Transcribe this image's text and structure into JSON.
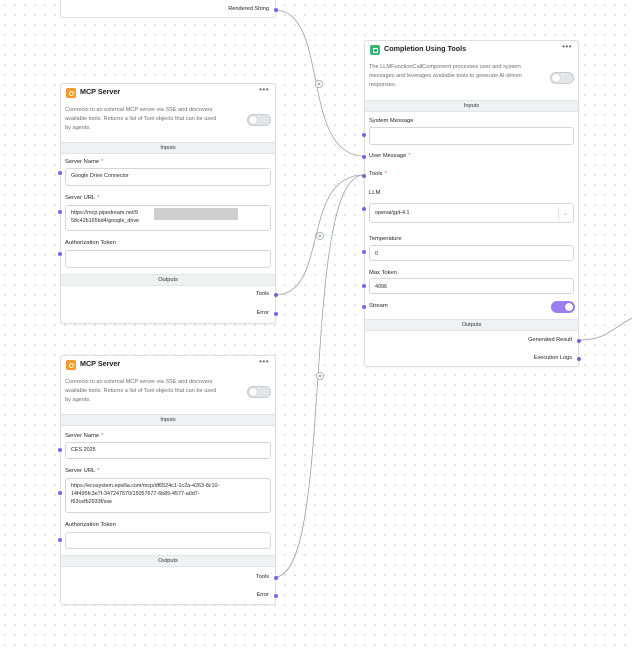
{
  "colors": {
    "accent": "#7b62e0",
    "toggle_on": "#9b7ef2",
    "mcp_icon": "#f09a2a",
    "llm_icon": "#3cb371",
    "required": "#e45757",
    "edge": "#9aa0aa"
  },
  "top_node": {
    "output_rendered_string": "Rendered String"
  },
  "mcp1": {
    "icon": "mcp-server-icon",
    "title": "MCP Server",
    "menu": "•••",
    "description_lines": [
      "Connects to an external MCP server via SSE and discovers",
      "available tools. Returns a list of Tool objects that can be used",
      "by agents."
    ],
    "inputs_header": "Inputs",
    "server_name_label": "Server Name",
    "server_name_value": "Google Drive Connector",
    "server_url_label": "Server URL",
    "server_url_line1": "https://mcp.pipedream.net/9",
    "server_url_line2": "58c42b165bd4/google_drive",
    "auth_token_label": "Authorization Token",
    "auth_token_value": "",
    "outputs_header": "Outputs",
    "output_tools": "Tools",
    "output_error": "Error",
    "required_mark": "*"
  },
  "mcp2": {
    "icon": "mcp-server-icon",
    "title": "MCP Server",
    "menu": "•••",
    "description_lines": [
      "Connects to an external MCP server via SSE and discovers",
      "available tools. Returns a list of Tool objects that can be used",
      "by agents."
    ],
    "inputs_header": "Inputs",
    "server_name_label": "Server Name",
    "server_name_value": "CES 2025",
    "server_url_label": "Server URL",
    "server_url_line1": "https://ecosystem.epsilla.com/mcp/df6524c1-1c2a-4263-8c10-",
    "server_url_line2": "14f495fc3e7f-347247570/15057677-6b85-4577-a0d7-",
    "server_url_line3": "f63cefb2933f/sse",
    "auth_token_label": "Authorization Token",
    "auth_token_value": "",
    "outputs_header": "Outputs",
    "output_tools": "Tools",
    "output_error": "Error",
    "required_mark": "*"
  },
  "completion": {
    "icon": "llm-component-icon",
    "title": "Completion Using Tools",
    "menu": "•••",
    "description_lines": [
      "The LLMFunctionCallComponent processes user and system",
      "messages and leverages available tools to generate AI-driven",
      "responses."
    ],
    "inputs_header": "Inputs",
    "system_message_label": "System Message",
    "system_message_value": "",
    "user_message_label": "User Message",
    "tools_label": "Tools",
    "llm_label": "LLM",
    "llm_value": "openai/gpt-4.1",
    "temperature_label": "Temperature",
    "temperature_value": "0",
    "max_token_label": "Max Token",
    "max_token_value": "4096",
    "stream_label": "Stream",
    "stream_on": true,
    "outputs_header": "Outputs",
    "output_generated": "Generated Result",
    "output_logs": "Execution Logs",
    "required_mark": "*"
  }
}
